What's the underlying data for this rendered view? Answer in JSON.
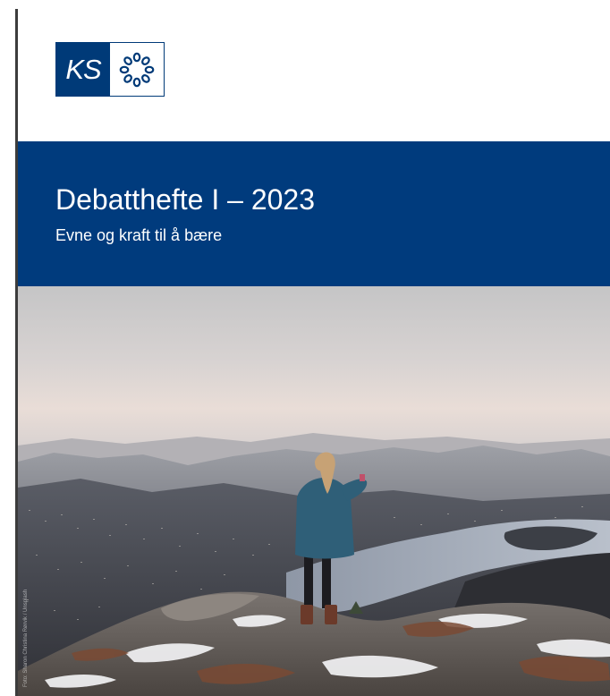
{
  "logo": {
    "text": "KS",
    "emblem_icon": "chain-ring-emblem-icon"
  },
  "banner": {
    "title": "Debatthefte I – 2023",
    "subtitle": "Evne og kraft til å bære"
  },
  "photo": {
    "credit": "Foto: Sharon Christina Rørvik / Unsplash"
  },
  "colors": {
    "brand_blue": "#003b7d",
    "white": "#ffffff"
  }
}
